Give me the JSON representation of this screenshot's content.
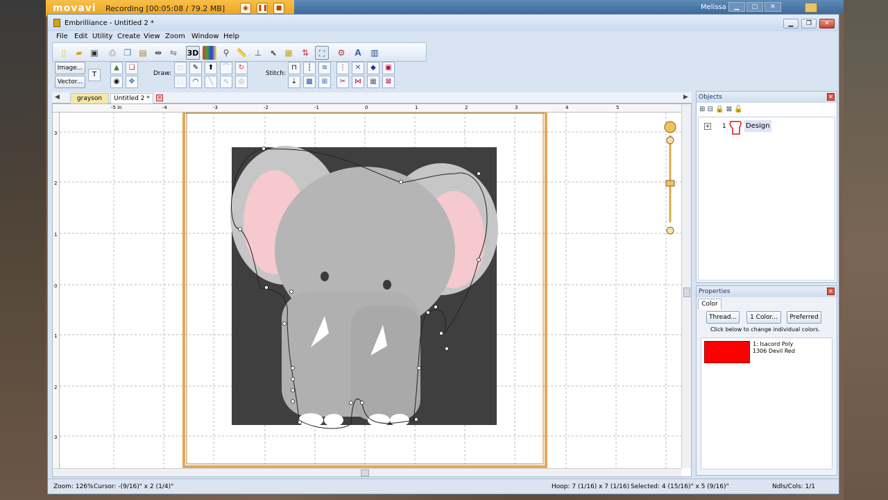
{
  "recorder": {
    "logo": "movavi",
    "status": "Recording  [00:05:08 / 79.2 MB]",
    "buttons": [
      "camera-icon",
      "pause-icon",
      "stop-icon"
    ]
  },
  "os": {
    "user": "Melissa",
    "buttons": {
      "minimize": "▁",
      "maximize": "□",
      "close": "✕"
    }
  },
  "app": {
    "title": "Embrilliance - Untitled 2 *",
    "menu": [
      "File",
      "Edit",
      "Utility",
      "Create",
      "View",
      "Zoom",
      "Window",
      "Help"
    ],
    "window_buttons": {
      "minimize": "▁",
      "restore": "❐",
      "close": "✕"
    }
  },
  "toolbar": {
    "image_btn": "Image...",
    "vector_btn": "Vector...",
    "draw_label": "Draw:",
    "stitch_label": "Stitch:",
    "threed_label": "3D"
  },
  "tabs": [
    {
      "label": "grayson"
    },
    {
      "label": "Untitled 2 *"
    }
  ],
  "ruler": {
    "h_ticks": [
      "-5 in",
      "-4",
      "-3",
      "-2",
      "-1",
      "0",
      "1",
      "2",
      "3",
      "4",
      "5"
    ],
    "v_ticks": [
      "3",
      "2",
      "1",
      "0",
      "1",
      "2",
      "3"
    ]
  },
  "objects_panel": {
    "title": "Objects",
    "item_index": "1",
    "item_label": "Design"
  },
  "properties_panel": {
    "title": "Properties",
    "tab": "Color",
    "thread_btn": "Thread...",
    "color_btn": "1 Color...",
    "preferred_btn": "Preferred",
    "hint": "Click below to change individual colors.",
    "color_line1": "1: Isacord Poly",
    "color_line2": "1306 Devil Red",
    "swatch_color": "#ff0000"
  },
  "status": {
    "zoom": "Zoom: 126%",
    "cursor": "Cursor: -(9/16)\" x 2 (1/4)\"",
    "hoop": "Hoop: 7 (1/16) x 7 (1/16)",
    "selected": "Selected: 4 (15/16)\" x 5 (9/16)\"",
    "ndls": "Ndls/Cols: 1/1"
  },
  "colors": {
    "hoop_frame": "#e0a95a",
    "artwork_bg": "#3f3f3f",
    "elephant_body": "#b5b5b5",
    "ear_inner": "#f5c9cd"
  }
}
